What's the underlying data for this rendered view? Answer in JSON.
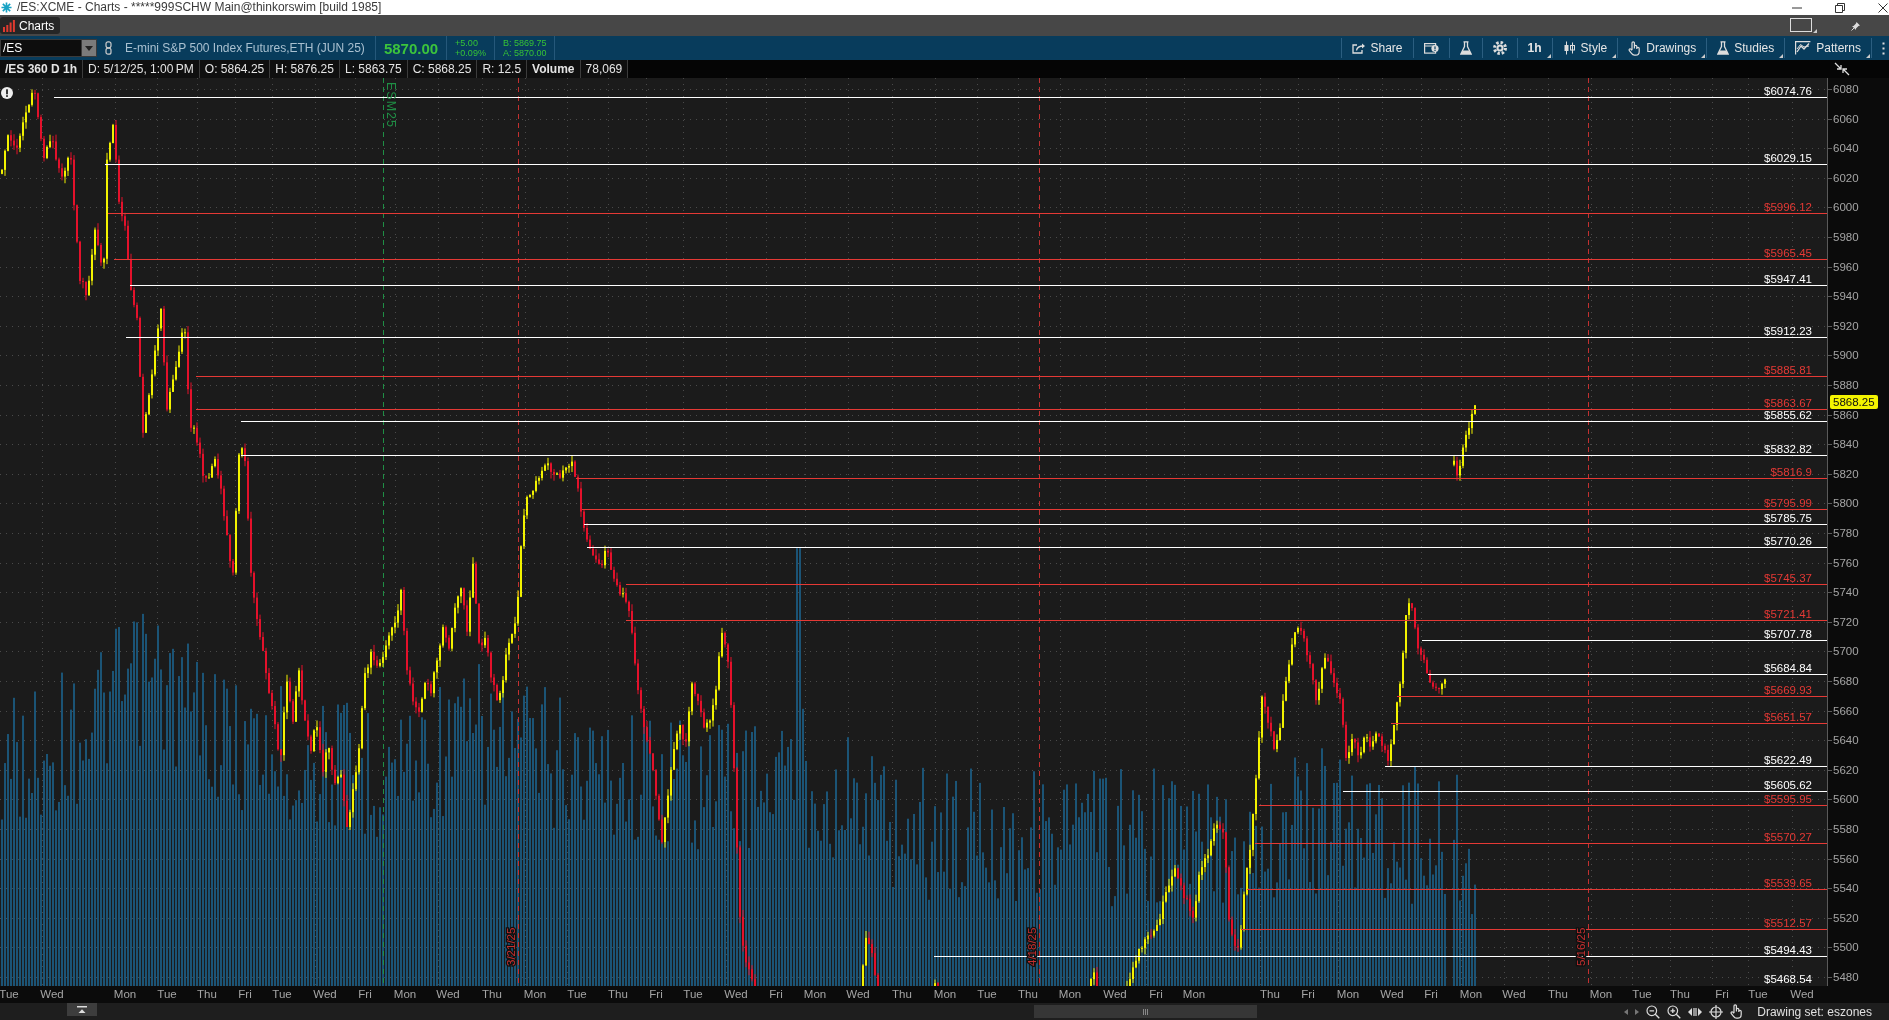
{
  "window": {
    "title": "/ES:XCME - Charts - *****999SCHW Main@thinkorswim [build 1985]"
  },
  "tabs": [
    {
      "label": "Charts",
      "selected": true
    }
  ],
  "toolbar": {
    "symbol": "/ES",
    "description": "E-mini S&P 500 Index Futures,ETH (JUN 25)",
    "last": "5870.00",
    "change": "+5.00",
    "change_percent": "+0.09%",
    "bid": "B: 5869.75",
    "ask": "A: 5870.00",
    "buttons": [
      {
        "kind": "share",
        "label": "Share",
        "dropdown": false
      },
      {
        "kind": "events",
        "dropdown": false
      },
      {
        "kind": "flask",
        "dropdown": false
      },
      {
        "kind": "settings",
        "dropdown": false
      },
      {
        "kind": "interval",
        "label": "1h",
        "dropdown": true
      },
      {
        "kind": "style",
        "label": "Style",
        "dropdown": true
      },
      {
        "kind": "drawings",
        "label": "Drawings",
        "dropdown": true
      },
      {
        "kind": "studies",
        "label": "Studies",
        "dropdown": true
      },
      {
        "kind": "patterns",
        "label": "Patterns",
        "dropdown": true
      }
    ]
  },
  "info_bar": {
    "title": "/ES 360 D 1h",
    "cells": [
      "D: 5/12/25, 1:00 PM",
      "O: 5864.25",
      "H: 5876.25",
      "L: 5863.75",
      "C: 5868.25",
      "R: 12.5"
    ],
    "volume_label": "Volume",
    "volume": "78,069"
  },
  "chart": {
    "levels": [
      {
        "label": "$6074.76",
        "color": "#ffffff"
      },
      {
        "label": "$6029.15",
        "color": "#ffffff"
      },
      {
        "label": "$5996.12",
        "color": "#e53935"
      },
      {
        "label": "$5965.45",
        "color": "#e53935"
      },
      {
        "label": "$5947.41",
        "color": "#ffffff"
      },
      {
        "label": "$5912.23",
        "color": "#ffffff"
      },
      {
        "label": "$5885.81",
        "color": "#e53935"
      },
      {
        "label": "$5863.67",
        "color": "#e53935"
      },
      {
        "label": "$5855.62",
        "color": "#ffffff"
      },
      {
        "label": "$5832.82",
        "color": "#ffffff"
      },
      {
        "label": "$5816.9",
        "color": "#e53935"
      },
      {
        "label": "$5795.99",
        "color": "#e53935"
      },
      {
        "label": "$5785.75",
        "color": "#ffffff"
      },
      {
        "label": "$5770.26",
        "color": "#ffffff"
      },
      {
        "label": "$5745.37",
        "color": "#e53935"
      },
      {
        "label": "$5721.41",
        "color": "#e53935"
      },
      {
        "label": "$5707.78",
        "color": "#ffffff"
      },
      {
        "label": "$5684.84",
        "color": "#ffffff"
      },
      {
        "label": "$5669.93",
        "color": "#e53935"
      },
      {
        "label": "$5651.57",
        "color": "#e53935"
      },
      {
        "label": "$5622.49",
        "color": "#ffffff"
      },
      {
        "label": "$5605.62",
        "color": "#ffffff"
      },
      {
        "label": "$5595.95",
        "color": "#e53935"
      },
      {
        "label": "$5570.27",
        "color": "#e53935"
      },
      {
        "label": "$5539.65",
        "color": "#e53935"
      },
      {
        "label": "$5512.57",
        "color": "#e53935"
      },
      {
        "label": "$5494.43",
        "color": "#ffffff"
      },
      {
        "label": "$5468.54",
        "color": "#ffffff"
      }
    ],
    "markers": [
      {
        "kind": "contract",
        "label": "ESM25",
        "color": "#1f8f45"
      },
      {
        "kind": "expiration",
        "label": "3/21/25",
        "color": "#c23030"
      },
      {
        "kind": "expiration",
        "label": "4/18/25",
        "color": "#c23030"
      },
      {
        "kind": "expiration",
        "label": "5/16/25",
        "color": "#c23030"
      }
    ],
    "price_axis": {
      "ticks": [
        "6080",
        "6060",
        "6040",
        "6020",
        "6000",
        "5980",
        "5960",
        "5940",
        "5920",
        "5900",
        "5880",
        "5860",
        "5840",
        "5820",
        "5800",
        "5780",
        "5760",
        "5740",
        "5720",
        "5700",
        "5680",
        "5660",
        "5640",
        "5620",
        "5600",
        "5580",
        "5560",
        "5540",
        "5520",
        "5500",
        "5480"
      ],
      "last_price": "5868.25"
    },
    "time_axis": [
      "Tue",
      "Wed",
      "Mon",
      "Tue",
      "Thu",
      "Fri",
      "Tue",
      "Wed",
      "Fri",
      "Mon",
      "Wed",
      "Thu",
      "Mon",
      "Tue",
      "Thu",
      "Fri",
      "Tue",
      "Wed",
      "Fri",
      "Mon",
      "Wed",
      "Thu",
      "Mon",
      "Tue",
      "Thu",
      "Mon",
      "Wed",
      "Fri",
      "Mon",
      "Thu",
      "Fri",
      "Mon",
      "Wed",
      "Fri",
      "Mon",
      "Wed",
      "Thu",
      "Mon",
      "Tue",
      "Thu",
      "Fri",
      "Tue",
      "Wed"
    ]
  },
  "status_bar": {
    "drawing_set": "Drawing set: eszones"
  }
}
